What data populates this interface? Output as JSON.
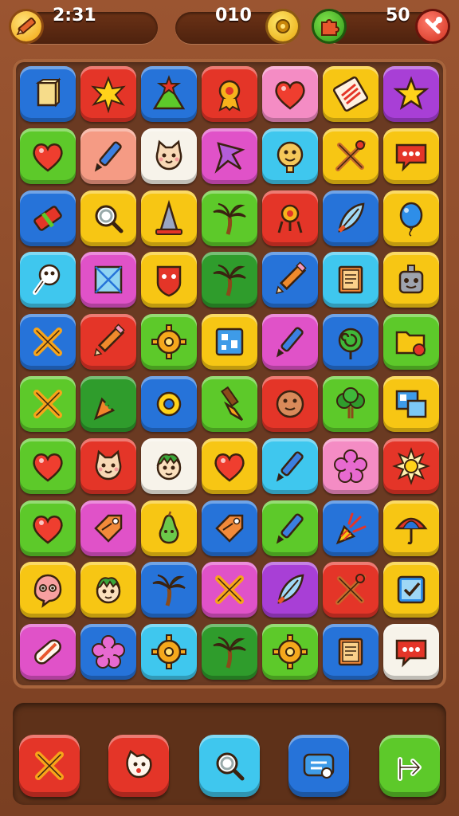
{
  "hud": {
    "timer": "2:31",
    "score": "010",
    "moves": "50"
  },
  "colors": {
    "red": "#e43528",
    "blue": "#2673d9",
    "yellow": "#f7c614",
    "green": "#5dc92a",
    "pink": "#f48cc4",
    "magenta": "#e052c8",
    "purple": "#a83fd6",
    "cyan": "#3fc7ee",
    "salmon": "#f59b84",
    "white": "#f7f3ea",
    "darkgreen": "#2f9c2c"
  },
  "board": {
    "rows": [
      [
        {
          "color": "blue",
          "icon": "box-icon"
        },
        {
          "color": "red",
          "icon": "star-burst-icon"
        },
        {
          "color": "blue",
          "icon": "triangle-star-icon"
        },
        {
          "color": "red",
          "icon": "medal-icon"
        },
        {
          "color": "pink",
          "icon": "heart-icon"
        },
        {
          "color": "yellow",
          "icon": "striped-card-icon"
        },
        {
          "color": "purple",
          "icon": "star-icon"
        }
      ],
      [
        {
          "color": "green",
          "icon": "heart-icon"
        },
        {
          "color": "salmon",
          "icon": "pen-icon"
        },
        {
          "color": "white",
          "icon": "cat-face-icon"
        },
        {
          "color": "magenta",
          "icon": "star-shape-icon"
        },
        {
          "color": "cyan",
          "icon": "cookie-face-icon"
        },
        {
          "color": "yellow",
          "icon": "cross-sticks-icon"
        },
        {
          "color": "yellow",
          "icon": "speech-bubble-icon"
        }
      ],
      [
        {
          "color": "blue",
          "icon": "eraser-icon"
        },
        {
          "color": "yellow",
          "icon": "magnifier-icon"
        },
        {
          "color": "yellow",
          "icon": "cone-icon"
        },
        {
          "color": "green",
          "icon": "palm-tree-icon"
        },
        {
          "color": "red",
          "icon": "robot-icon"
        },
        {
          "color": "blue",
          "icon": "feather-icon"
        },
        {
          "color": "yellow",
          "icon": "balloon-icon"
        }
      ],
      [
        {
          "color": "cyan",
          "icon": "bone-icon"
        },
        {
          "color": "magenta",
          "icon": "envelope-icon"
        },
        {
          "color": "yellow",
          "icon": "shield-face-icon"
        },
        {
          "color": "darkgreen",
          "icon": "palm-tree-icon"
        },
        {
          "color": "blue",
          "icon": "pencil-icon"
        },
        {
          "color": "cyan",
          "icon": "book-icon"
        },
        {
          "color": "yellow",
          "icon": "robot-face-icon"
        }
      ],
      [
        {
          "color": "blue",
          "icon": "cross-icon"
        },
        {
          "color": "red",
          "icon": "pencil-icon"
        },
        {
          "color": "green",
          "icon": "gear-icon"
        },
        {
          "color": "yellow",
          "icon": "map-icon"
        },
        {
          "color": "magenta",
          "icon": "pen-icon"
        },
        {
          "color": "blue",
          "icon": "spiral-icon"
        },
        {
          "color": "green",
          "icon": "folder-icon"
        }
      ],
      [
        {
          "color": "green",
          "icon": "cross-icon"
        },
        {
          "color": "darkgreen",
          "icon": "carrot-icon"
        },
        {
          "color": "blue",
          "icon": "ring-icon"
        },
        {
          "color": "green",
          "icon": "brush-icon"
        },
        {
          "color": "red",
          "icon": "cookie-icon"
        },
        {
          "color": "green",
          "icon": "tree-icon"
        },
        {
          "color": "yellow",
          "icon": "photo-icon"
        }
      ],
      [
        {
          "color": "green",
          "icon": "heart-icon"
        },
        {
          "color": "red",
          "icon": "cat-face-icon"
        },
        {
          "color": "white",
          "icon": "boy-face-icon"
        },
        {
          "color": "yellow",
          "icon": "heart-icon"
        },
        {
          "color": "cyan",
          "icon": "pen-icon"
        },
        {
          "color": "pink",
          "icon": "flower-icon"
        },
        {
          "color": "red",
          "icon": "sun-icon"
        }
      ],
      [
        {
          "color": "green",
          "icon": "heart-icon"
        },
        {
          "color": "magenta",
          "icon": "tag-icon"
        },
        {
          "color": "yellow",
          "icon": "pear-icon"
        },
        {
          "color": "blue",
          "icon": "tag-icon"
        },
        {
          "color": "green",
          "icon": "pen-icon"
        },
        {
          "color": "blue",
          "icon": "party-horn-icon"
        },
        {
          "color": "yellow",
          "icon": "umbrella-icon"
        }
      ],
      [
        {
          "color": "yellow",
          "icon": "ghost-icon"
        },
        {
          "color": "yellow",
          "icon": "boy-face-icon"
        },
        {
          "color": "blue",
          "icon": "palm-tree-icon"
        },
        {
          "color": "magenta",
          "icon": "cross-icon"
        },
        {
          "color": "purple",
          "icon": "feather-icon"
        },
        {
          "color": "red",
          "icon": "cross-sticks-icon"
        },
        {
          "color": "yellow",
          "icon": "checkbox-icon"
        }
      ],
      [
        {
          "color": "magenta",
          "icon": "bandage-icon"
        },
        {
          "color": "blue",
          "icon": "flower-icon"
        },
        {
          "color": "cyan",
          "icon": "gear-icon"
        },
        {
          "color": "darkgreen",
          "icon": "palm-tree-icon"
        },
        {
          "color": "green",
          "icon": "gear-icon"
        },
        {
          "color": "blue",
          "icon": "book-icon"
        },
        {
          "color": "white",
          "icon": "speech-bubble-icon"
        }
      ]
    ]
  },
  "powerups": [
    {
      "color": "red",
      "icon": "cross-icon"
    },
    {
      "color": "red",
      "icon": "cat-head-icon"
    },
    {
      "color": "cyan",
      "icon": "magnifier-icon"
    },
    {
      "color": "blue",
      "icon": "chat-icon"
    },
    {
      "color": "green",
      "icon": "arrow-turn-icon"
    }
  ]
}
